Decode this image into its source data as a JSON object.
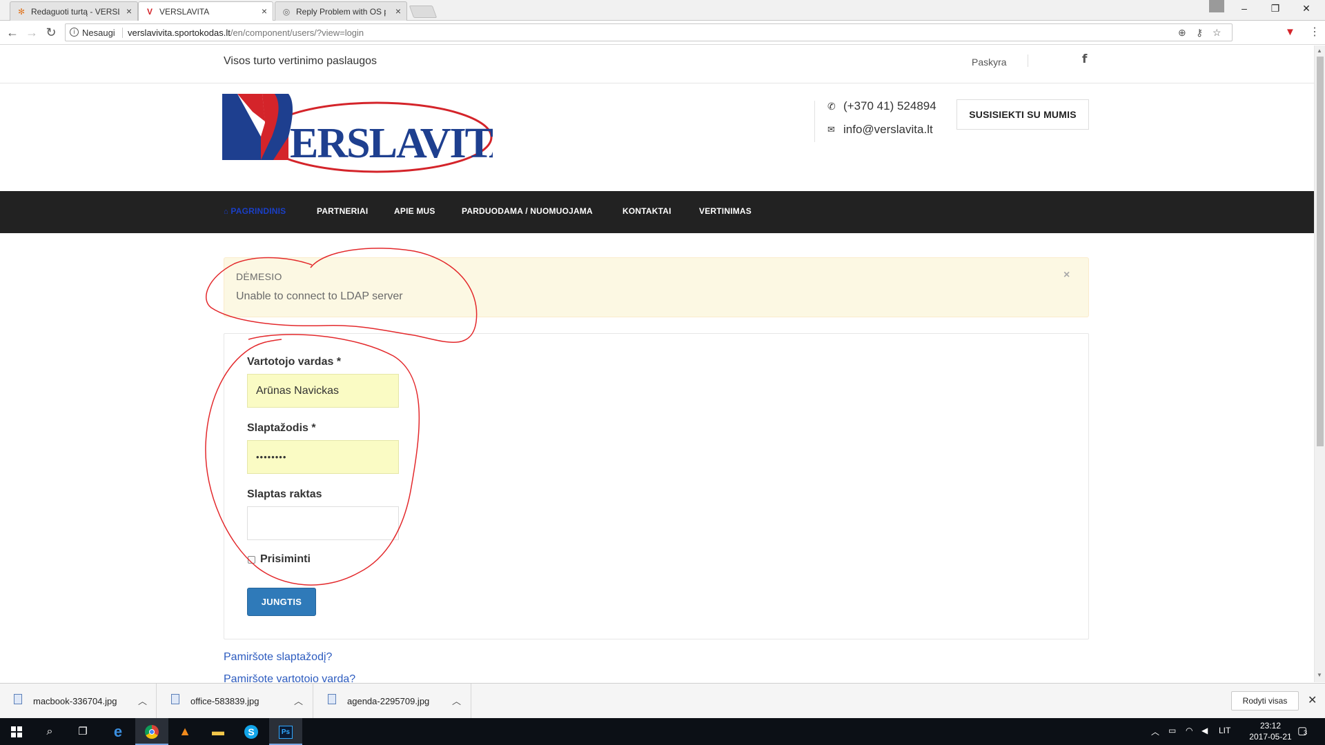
{
  "browser": {
    "tabs": [
      {
        "label": "Redaguoti turtą - VERSLAVITA",
        "active": false
      },
      {
        "label": "VERSLAVITA",
        "active": true
      },
      {
        "label": "Reply Problem with OS password",
        "active": false
      }
    ],
    "security_label": "Nesaugi",
    "url_host": "verslavivita.sportokodas.lt",
    "url_path": "/en/component/users/?view=login"
  },
  "topbar": {
    "tagline": "Visos turto vertinimo paslaugos",
    "account_link": "Paskyra",
    "facebook_icon": "f"
  },
  "header": {
    "logo_text": "ERSLAVITA",
    "phone": "(+370 41) 524894",
    "email": "info@verslavita.lt",
    "contact_button": "SUSISIEKTI SU MUMIS"
  },
  "nav": {
    "items": [
      {
        "label": "PAGRINDINIS",
        "active": true
      },
      {
        "label": "PARTNERIAI"
      },
      {
        "label": "APIE MUS"
      },
      {
        "label": "PARDUODAMA / NUOMUOJAMA"
      },
      {
        "label": "KONTAKTAI"
      },
      {
        "label": "VERTINIMAS"
      }
    ]
  },
  "alert": {
    "heading": "DĖMESIO",
    "message": "Unable to connect to LDAP server",
    "close": "×"
  },
  "login": {
    "username_label": "Vartotojo vardas *",
    "username_value": "Arūnas Navickas",
    "password_label": "Slaptažodis *",
    "password_value": "••••••••",
    "secret_label": "Slaptas raktas",
    "secret_value": "",
    "remember_label": "Prisiminti",
    "submit_label": "JUNGTIS"
  },
  "links": {
    "forgot_password": "Pamiršote slaptažodį?",
    "forgot_username": "Pamiršote vartotojo vardą?"
  },
  "downloads": {
    "items": [
      "macbook-336704.jpg",
      "office-583839.jpg",
      "agenda-2295709.jpg"
    ],
    "show_all": "Rodyti visas"
  },
  "taskbar": {
    "language": "LIT",
    "time": "23:12",
    "date": "2017-05-21",
    "notifications": "3"
  },
  "colors": {
    "nav_bg": "#222222",
    "alert_bg": "#fcf8e3",
    "button_blue": "#2f7ab9",
    "link_blue": "#2c5bbf",
    "autofill_yellow": "#fafbc4",
    "annotation_red": "#e3282b"
  }
}
